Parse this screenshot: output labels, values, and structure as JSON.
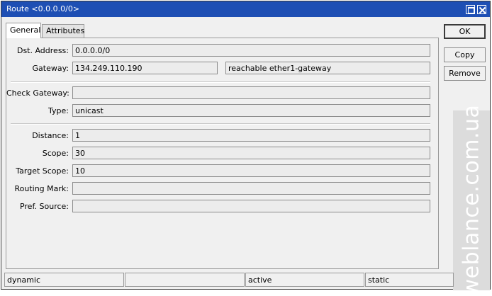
{
  "window": {
    "title": "Route <0.0.0.0/0>"
  },
  "tabs": [
    {
      "label": "General",
      "active": true
    },
    {
      "label": "Attributes",
      "active": false
    }
  ],
  "buttons": {
    "ok": "OK",
    "copy": "Copy",
    "remove": "Remove"
  },
  "fields": {
    "dst_address": {
      "label": "Dst. Address:",
      "value": "0.0.0.0/0"
    },
    "gateway": {
      "label": "Gateway:",
      "value": "134.249.110.190",
      "status": "reachable ether1-gateway"
    },
    "check_gateway": {
      "label": "Check Gateway:",
      "value": ""
    },
    "type": {
      "label": "Type:",
      "value": "unicast"
    },
    "distance": {
      "label": "Distance:",
      "value": "1"
    },
    "scope": {
      "label": "Scope:",
      "value": "30"
    },
    "target_scope": {
      "label": "Target Scope:",
      "value": "10"
    },
    "routing_mark": {
      "label": "Routing Mark:",
      "value": ""
    },
    "pref_source": {
      "label": "Pref. Source:",
      "value": ""
    }
  },
  "status_bar": [
    "dynamic",
    "",
    "active",
    "static"
  ],
  "watermark": "weblance.com.ua",
  "colors": {
    "titlebar": "#1e4fb4",
    "window_bg": "#f0f0f0",
    "field_bg": "#ececec"
  }
}
